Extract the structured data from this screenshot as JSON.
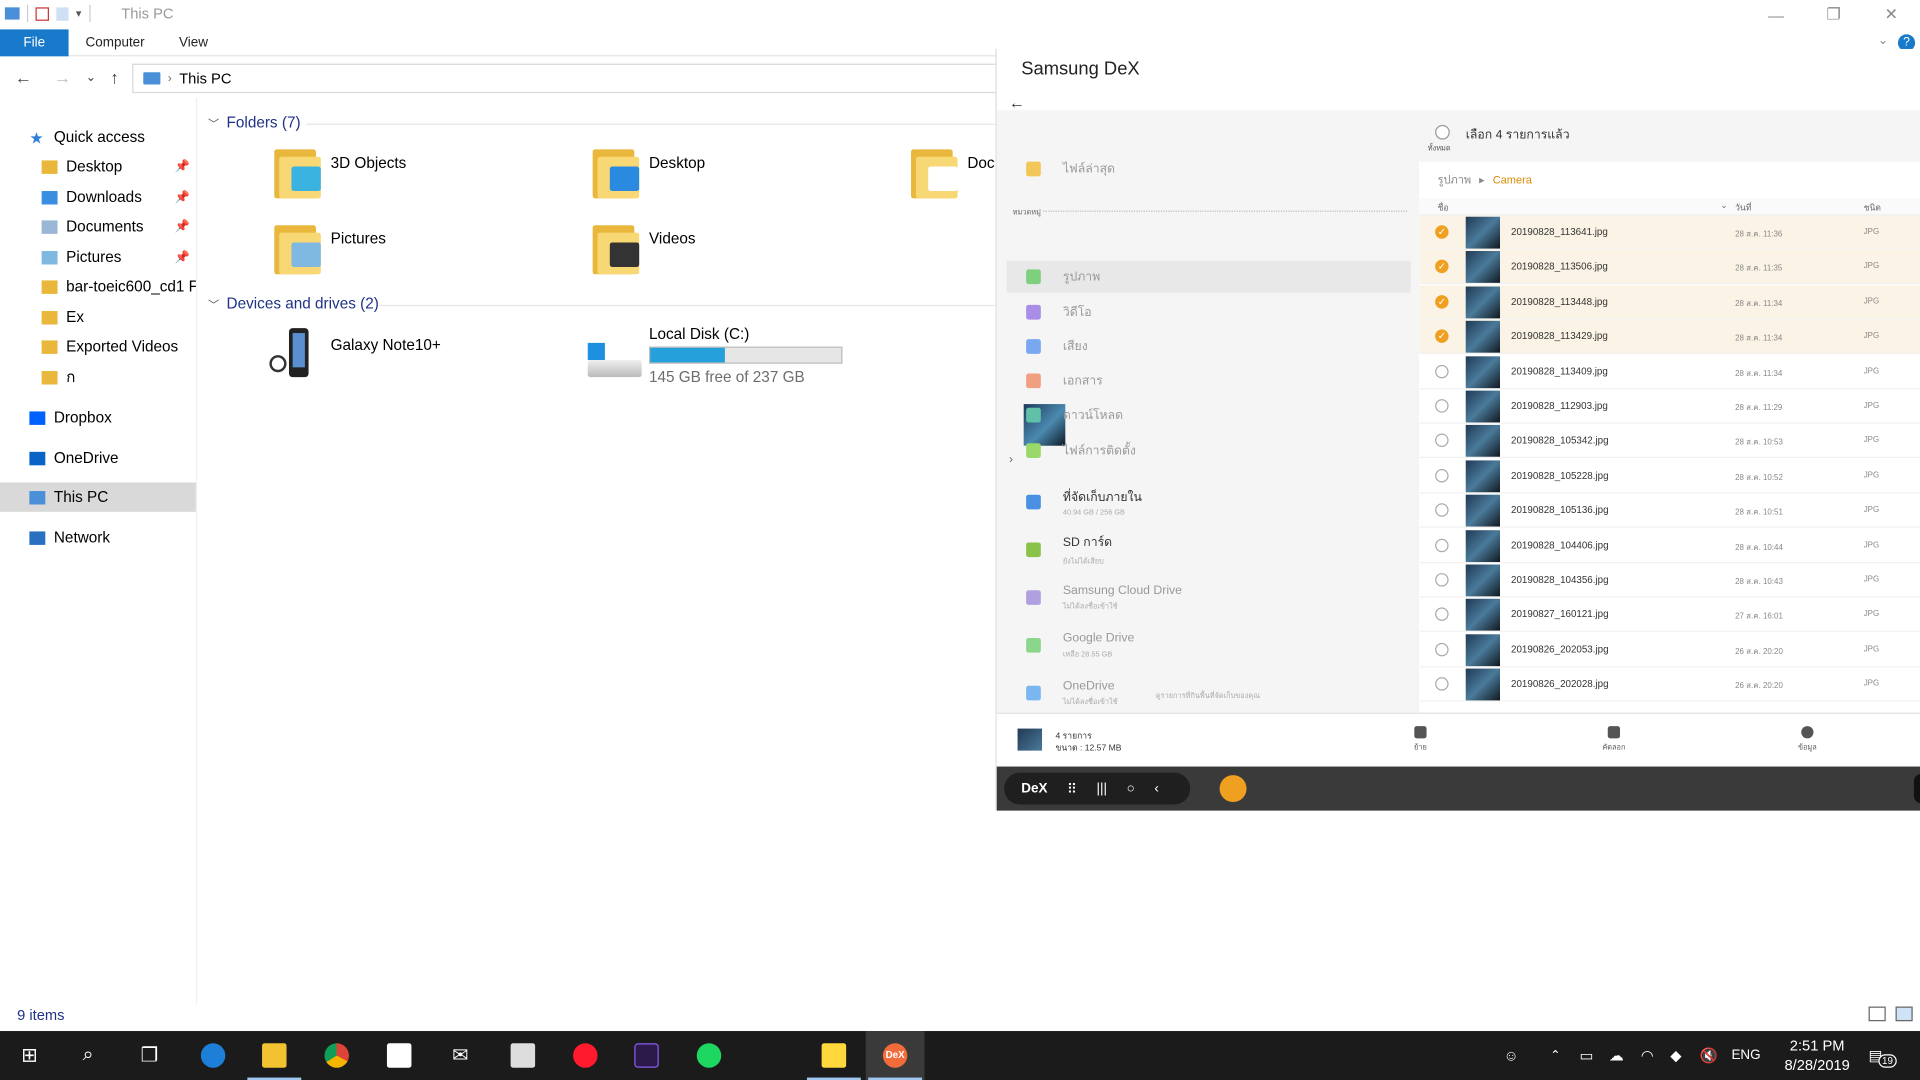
{
  "window": {
    "title": "This PC",
    "ribbon_tabs": [
      "File",
      "Computer",
      "View"
    ],
    "address": "This PC",
    "help": "?"
  },
  "nav": {
    "items": [
      {
        "label": "Quick access",
        "icon": "star-icon",
        "color": "#2f7fd8"
      },
      {
        "label": "Desktop",
        "icon": "folder-icon",
        "pinned": true
      },
      {
        "label": "Downloads",
        "icon": "download-folder-icon",
        "pinned": true
      },
      {
        "label": "Documents",
        "icon": "documents-icon",
        "pinned": true
      },
      {
        "label": "Pictures",
        "icon": "pictures-icon",
        "pinned": true
      },
      {
        "label": "bar-toeic600_cd1 Fo",
        "icon": "folder-icon"
      },
      {
        "label": "Ex",
        "icon": "folder-icon"
      },
      {
        "label": "Exported Videos",
        "icon": "folder-icon"
      },
      {
        "label": "ก",
        "icon": "folder-icon"
      },
      {
        "label": "Dropbox",
        "icon": "dropbox-icon"
      },
      {
        "label": "OneDrive",
        "icon": "onedrive-icon"
      },
      {
        "label": "This PC",
        "icon": "pc-icon",
        "selected": true
      },
      {
        "label": "Network",
        "icon": "network-icon"
      }
    ]
  },
  "main": {
    "folders_header": "Folders (7)",
    "folders": [
      {
        "label": "3D Objects",
        "overlay": "#3bb3e0"
      },
      {
        "label": "Desktop",
        "overlay": "#2a8ae0"
      },
      {
        "label": "Doc",
        "overlay": "#ffffff"
      },
      {
        "label": "Pictures",
        "overlay": "#7fb8e0"
      },
      {
        "label": "Videos",
        "overlay": "#333333"
      }
    ],
    "devices_header": "Devices and drives (2)",
    "devices": [
      {
        "label": "Galaxy Note10+"
      },
      {
        "label": "Local Disk (C:)",
        "free": "145 GB free of 237 GB",
        "used_fraction": 0.388
      }
    ],
    "status": "9 items"
  },
  "dex": {
    "title": "Samsung DeX",
    "select_all": "ทั้งหมด",
    "selected_text": "เลือก 4 รายการแล้ว",
    "breadcrumb_root": "รูปภาพ",
    "breadcrumb_leaf": "Camera",
    "col_name": "ชื่อ",
    "col_date": "วันที่",
    "col_type": "ชนิด",
    "categories_label": "หมวดหมู่",
    "categories": [
      {
        "label": "ไฟล์ล่าสุด",
        "color": "#f3c65a"
      },
      {
        "label": "รูปภาพ",
        "color": "#7ed07e",
        "selected": true
      },
      {
        "label": "วิดีโอ",
        "color": "#a98ee8"
      },
      {
        "label": "เสียง",
        "color": "#7aa8f0"
      },
      {
        "label": "เอกสาร",
        "color": "#f0a080"
      },
      {
        "label": "ดาวน์โหลด",
        "color": "#60c0a8"
      },
      {
        "label": "ไฟล์การติดตั้ง",
        "color": "#9bd86a"
      }
    ],
    "storage": [
      {
        "label": "ที่จัดเก็บภายใน",
        "sub": "40.94 GB / 256 GB",
        "color": "#4a90e2",
        "dark": true
      },
      {
        "label": "SD การ์ด",
        "sub": "ยังไม่ได้เสียบ",
        "color": "#8bc34a",
        "dark": true
      },
      {
        "label": "Samsung Cloud Drive",
        "sub": "ไม่ได้ลงชื่อเข้าใช้",
        "color": "#b0a0e0"
      },
      {
        "label": "Google Drive",
        "sub": "เหลือ 28.55 GB",
        "color": "#8cd68c"
      },
      {
        "label": "OneDrive",
        "sub": "ไม่ได้ลงชื่อเข้าใช้",
        "color": "#7ab6f0"
      }
    ],
    "footer_note": "ดูรายการที่กินพื้นที่จัดเก็บของคุณ",
    "files": [
      {
        "name": "20190828_113641.jpg",
        "date": "28 ส.ค. 11:36",
        "type": "JPG",
        "checked": true
      },
      {
        "name": "20190828_113506.jpg",
        "date": "28 ส.ค. 11:35",
        "type": "JPG",
        "checked": true
      },
      {
        "name": "20190828_113448.jpg",
        "date": "28 ส.ค. 11:34",
        "type": "JPG",
        "checked": true
      },
      {
        "name": "20190828_113429.jpg",
        "date": "28 ส.ค. 11:34",
        "type": "JPG",
        "checked": true
      },
      {
        "name": "20190828_113409.jpg",
        "date": "28 ส.ค. 11:34",
        "type": "JPG",
        "checked": false
      },
      {
        "name": "20190828_112903.jpg",
        "date": "28 ส.ค. 11:29",
        "type": "JPG",
        "checked": false
      },
      {
        "name": "20190828_105342.jpg",
        "date": "28 ส.ค. 10:53",
        "type": "JPG",
        "checked": false
      },
      {
        "name": "20190828_105228.jpg",
        "date": "28 ส.ค. 10:52",
        "type": "JPG",
        "checked": false
      },
      {
        "name": "20190828_105136.jpg",
        "date": "28 ส.ค. 10:51",
        "type": "JPG",
        "checked": false
      },
      {
        "name": "20190828_104406.jpg",
        "date": "28 ส.ค. 10:44",
        "type": "JPG",
        "checked": false
      },
      {
        "name": "20190828_104356.jpg",
        "date": "28 ส.ค. 10:43",
        "type": "JPG",
        "checked": false
      },
      {
        "name": "20190827_160121.jpg",
        "date": "27 ส.ค. 16:01",
        "type": "JPG",
        "checked": false
      },
      {
        "name": "20190826_202053.jpg",
        "date": "26 ส.ค. 20:20",
        "type": "JPG",
        "checked": false
      },
      {
        "name": "20190826_202028.jpg",
        "date": "26 ส.ค. 20:20",
        "type": "JPG",
        "checked": false
      }
    ],
    "summary_count": "4 รายการ",
    "summary_size": "ขนาด : 12.57 MB",
    "actions": [
      "ย้าย",
      "คัดลอก",
      "ข้อมูล"
    ],
    "dex_label": "DeX"
  },
  "taskbar": {
    "apps": [
      "windows-start-icon",
      "search-icon",
      "task-view-icon",
      "edge-icon",
      "file-explorer-icon",
      "chrome-icon",
      "store-icon",
      "mail-icon",
      "app-icon",
      "opera-icon",
      "rush-icon",
      "spotify-icon",
      "sticky-notes-icon",
      "dex-icon"
    ],
    "dex_app_label": "DeX",
    "lang": "ENG",
    "time": "2:51 PM",
    "date": "8/28/2019",
    "notif_count": "19"
  }
}
